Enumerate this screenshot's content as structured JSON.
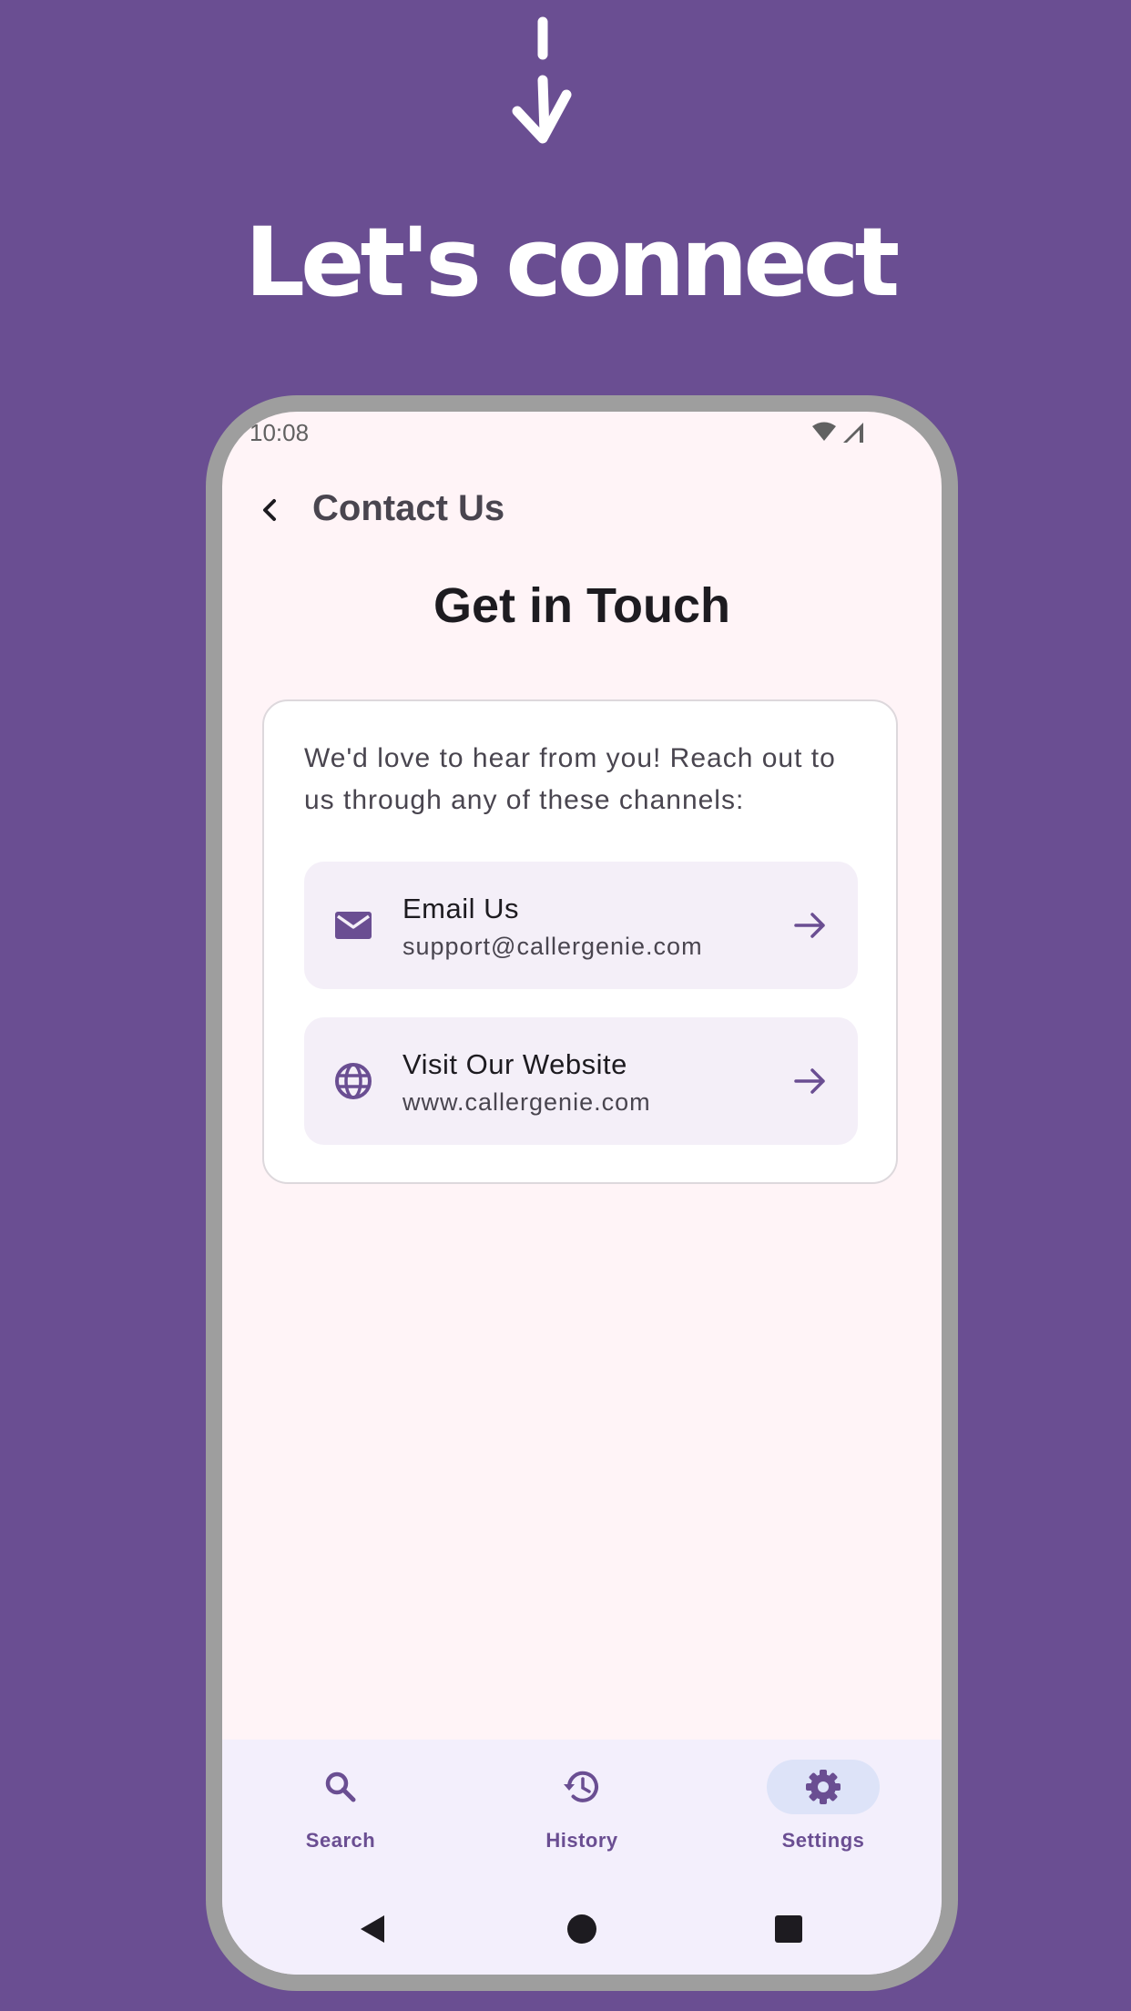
{
  "promo": {
    "headline": "Let's connect"
  },
  "status_bar": {
    "time": "10:08"
  },
  "app_bar": {
    "title": "Contact Us"
  },
  "content": {
    "section_title": "Get in Touch",
    "intro": "We'd love to hear from you! Reach out to us through any of these channels:",
    "items": [
      {
        "icon": "email-icon",
        "title": "Email Us",
        "subtitle": "support@callergenie.com"
      },
      {
        "icon": "globe-icon",
        "title": "Visit Our Website",
        "subtitle": "www.callergenie.com"
      }
    ]
  },
  "bottom_nav": {
    "items": [
      {
        "label": "Search",
        "icon": "search-icon"
      },
      {
        "label": "History",
        "icon": "history-icon"
      },
      {
        "label": "Settings",
        "icon": "settings-icon",
        "selected": true
      }
    ]
  },
  "colors": {
    "background": "#6a4e92",
    "screen": "#fff4f7",
    "accent": "#6a4e92",
    "item_bg": "#f4eff8",
    "nav_bg": "#f3effc",
    "nav_selected_pill": "#dde3f8"
  }
}
